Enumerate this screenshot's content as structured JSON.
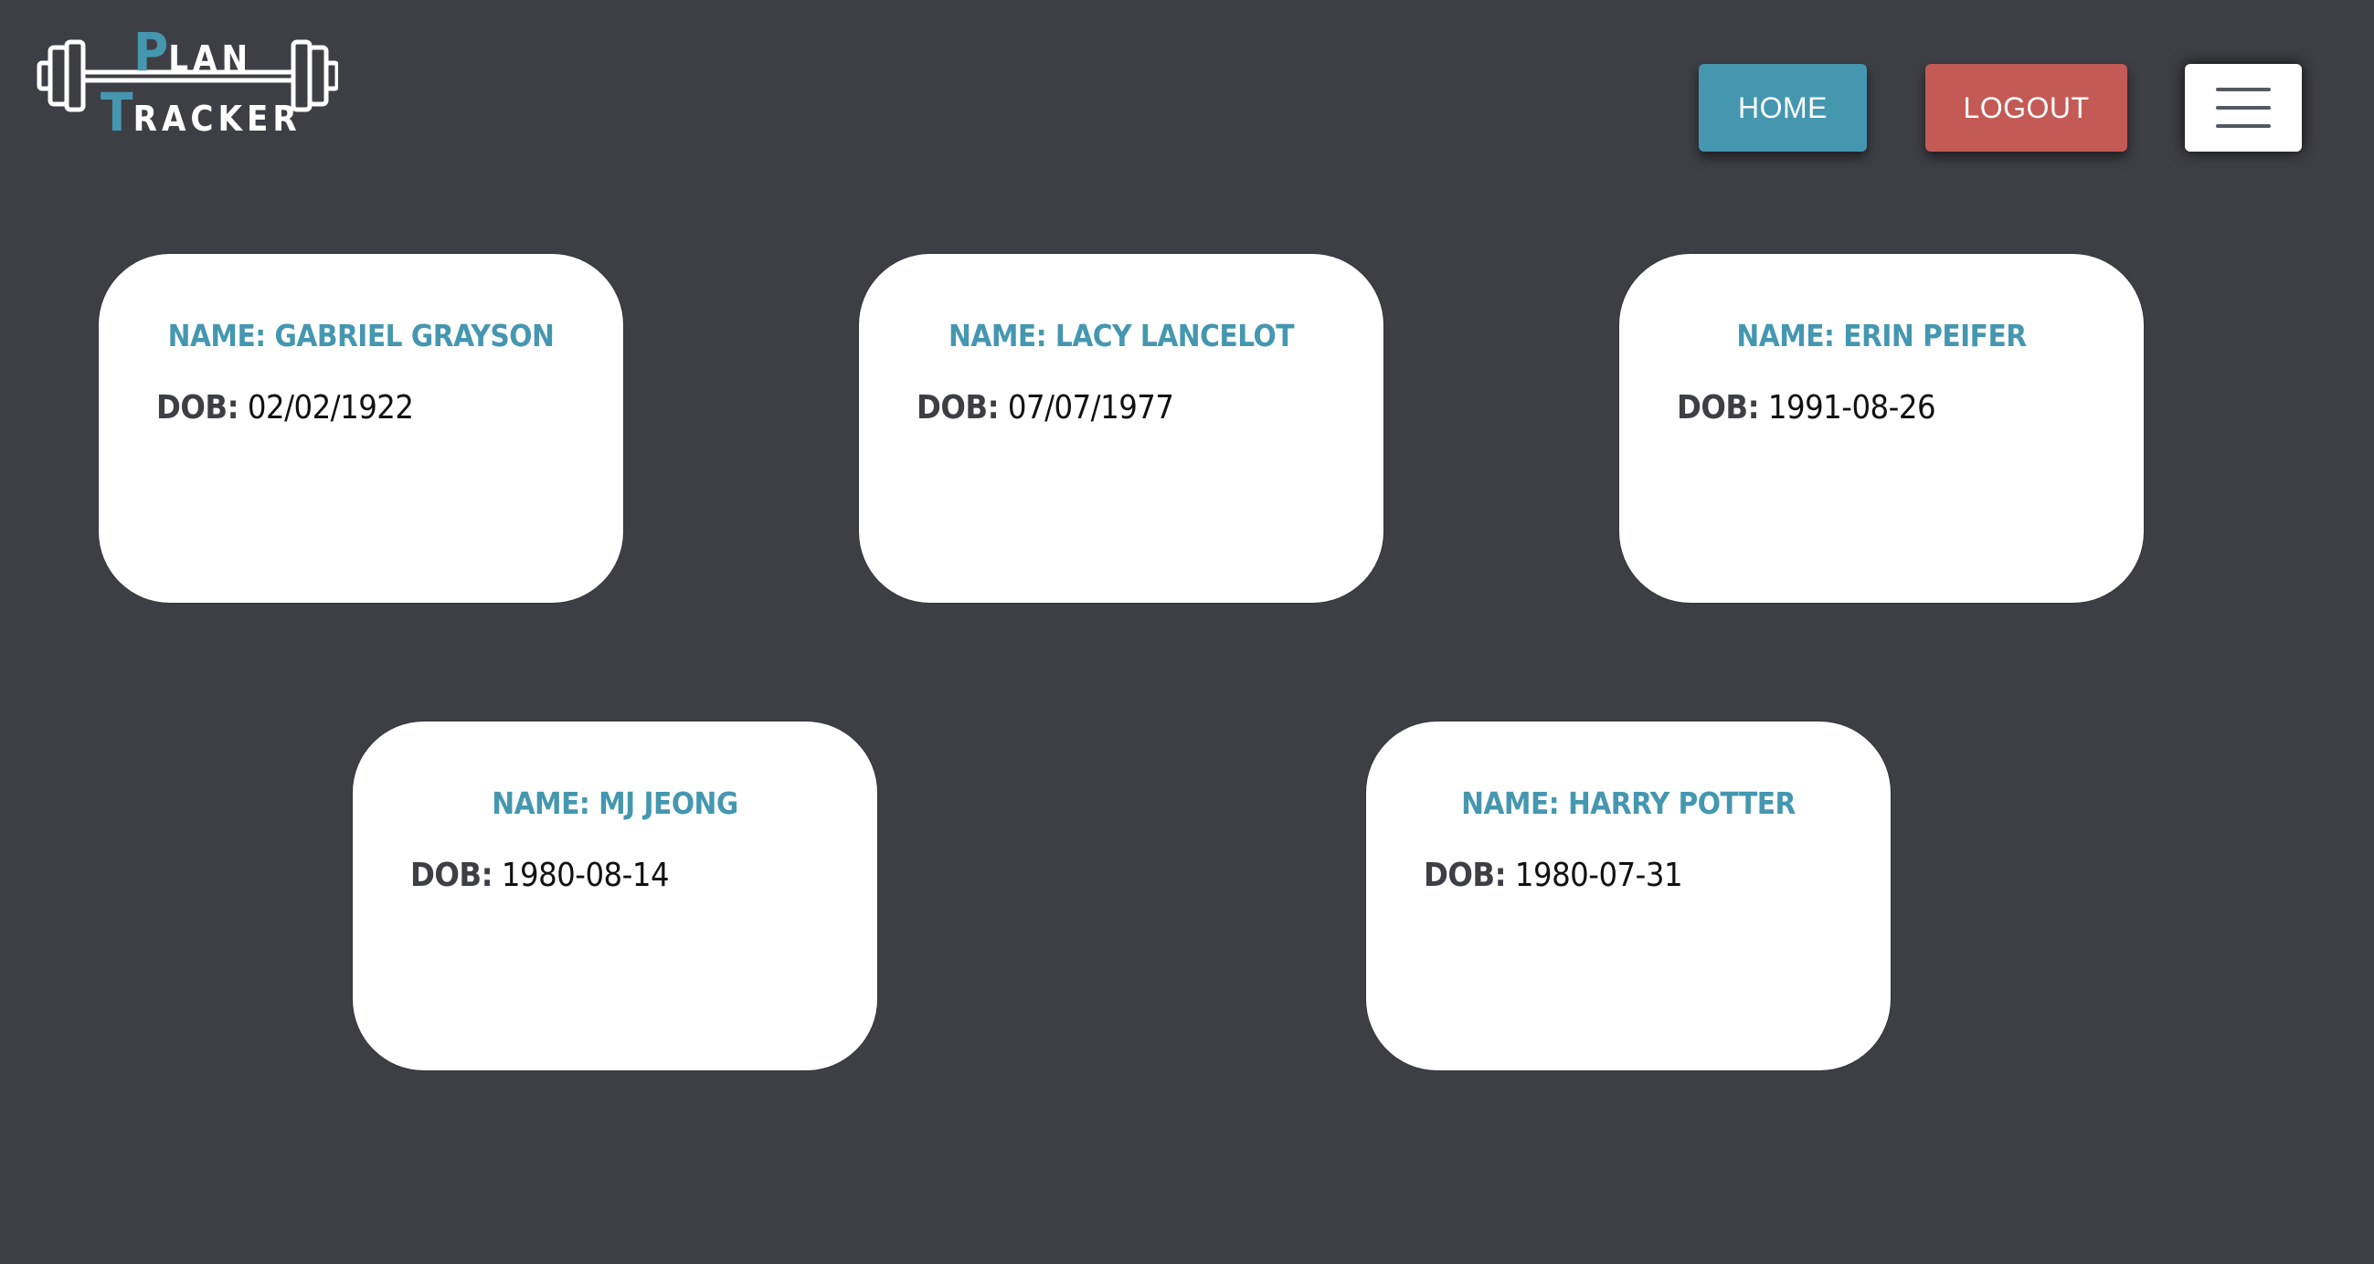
{
  "logo": {
    "plan_initial": "P",
    "plan_rest": "LAN",
    "tracker_initial": "T",
    "tracker_rest": "RACKER",
    "icon": "barbell-icon"
  },
  "nav": {
    "home_label": "HOME",
    "logout_label": "LOGOUT",
    "menu_icon": "hamburger-menu-icon"
  },
  "colors": {
    "background": "#3e3f45",
    "accent": "#4597b0",
    "logout": "#c45a55",
    "card": "#ffffff"
  },
  "clients": [
    {
      "name_label": "NAME: GABRIEL GRAYSON",
      "dob_label": "DOB:",
      "dob": "02/02/1922"
    },
    {
      "name_label": "NAME: LACY LANCELOT",
      "dob_label": "DOB:",
      "dob": "07/07/1977"
    },
    {
      "name_label": "NAME: ERIN PEIFER",
      "dob_label": "DOB:",
      "dob": "1991-08-26"
    },
    {
      "name_label": "NAME: MJ JEONG",
      "dob_label": "DOB:",
      "dob": "1980-08-14"
    },
    {
      "name_label": "NAME: HARRY POTTER",
      "dob_label": "DOB:",
      "dob": "1980-07-31"
    }
  ]
}
